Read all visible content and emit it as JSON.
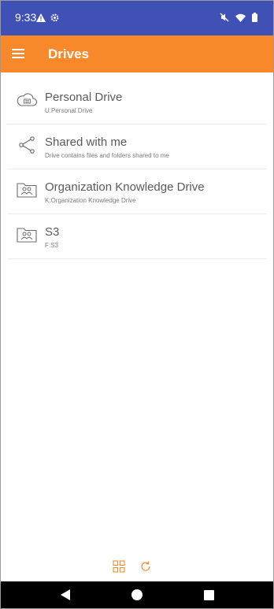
{
  "status_bar": {
    "time": "9:33",
    "left_icons": [
      "warning-icon",
      "gear-icon"
    ],
    "right_icons": [
      "mute-icon",
      "wifi-icon",
      "battery-icon"
    ]
  },
  "app_bar": {
    "title": "Drives",
    "menu_icon": "hamburger-menu-icon"
  },
  "drives": [
    {
      "name": "Personal Drive",
      "subtitle": "U:Personal Drive",
      "icon": "cloud-drive-icon"
    },
    {
      "name": "Shared with me",
      "subtitle": "Drive contains files and folders shared to me",
      "icon": "share-icon"
    },
    {
      "name": "Organization Knowledge Drive",
      "subtitle": "K:Organization Knowledge Drive",
      "icon": "group-folder-icon"
    },
    {
      "name": "S3",
      "subtitle": "F:S3",
      "icon": "group-folder-icon"
    }
  ],
  "bottom_toolbar": {
    "icons": [
      "grid-view-icon",
      "refresh-icon"
    ]
  },
  "nav_bar": {
    "buttons": [
      "back",
      "home",
      "recents"
    ]
  },
  "colors": {
    "status_bar": "#3f51b5",
    "app_bar": "#f7892b",
    "accent": "#f7892b",
    "icon_gray": "#6b6b6b"
  }
}
